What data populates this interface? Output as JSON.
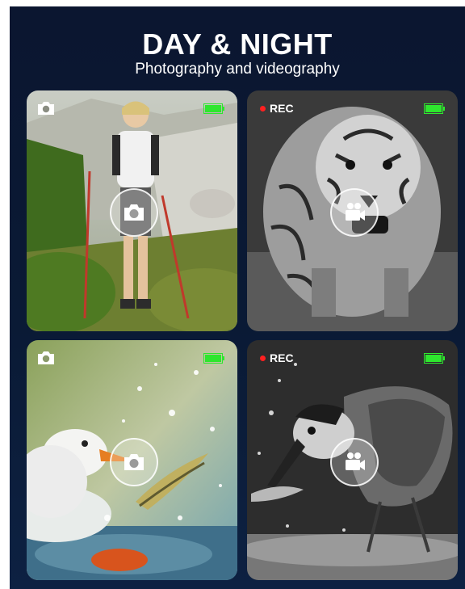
{
  "header": {
    "title": "DAY & NIGHT",
    "subtitle": "Photography and videography"
  },
  "cards": [
    {
      "mode": "photo",
      "scene": "hiker woman with trekking poles on mountain trail",
      "color": "full-color",
      "center_icon": "camera-icon",
      "status_icon": "camera-icon",
      "battery": "full"
    },
    {
      "mode": "video",
      "scene": "tiger walking toward camera",
      "color": "night-monochrome",
      "rec_label": "REC",
      "center_icon": "video-camera-icon",
      "battery": "full"
    },
    {
      "mode": "photo",
      "scene": "seagull catching fish in splashing water",
      "color": "full-color",
      "center_icon": "camera-icon",
      "status_icon": "camera-icon",
      "battery": "full"
    },
    {
      "mode": "video",
      "scene": "heron catching fish",
      "color": "night-monochrome",
      "rec_label": "REC",
      "center_icon": "video-camera-icon",
      "battery": "full"
    }
  ],
  "colors": {
    "panel_bg": "#0b1630",
    "battery": "#2ee62e",
    "rec_dot": "#ff2020"
  }
}
